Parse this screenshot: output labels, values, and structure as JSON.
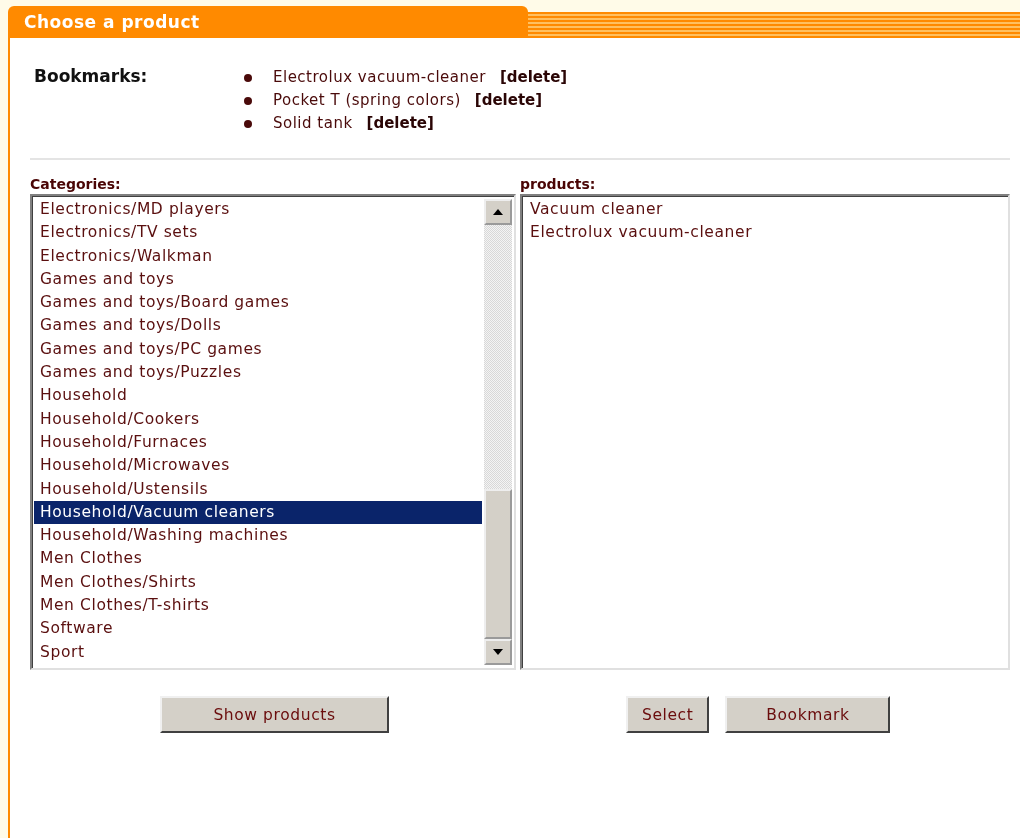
{
  "panel": {
    "title": "Choose a product"
  },
  "bookmarks": {
    "label": "Bookmarks:",
    "items": [
      {
        "name": "Electrolux vacuum-cleaner",
        "action": "[delete]"
      },
      {
        "name": "Pocket T (spring colors)",
        "action": "[delete]"
      },
      {
        "name": "Solid tank",
        "action": "[delete]"
      }
    ]
  },
  "categories": {
    "label": "Categories:",
    "items": [
      {
        "label": "Electronics/MD players",
        "selected": false
      },
      {
        "label": "Electronics/TV sets",
        "selected": false
      },
      {
        "label": "Electronics/Walkman",
        "selected": false
      },
      {
        "label": "Games and toys",
        "selected": false
      },
      {
        "label": "Games and toys/Board games",
        "selected": false
      },
      {
        "label": "Games and toys/Dolls",
        "selected": false
      },
      {
        "label": "Games and toys/PC games",
        "selected": false
      },
      {
        "label": "Games and toys/Puzzles",
        "selected": false
      },
      {
        "label": "Household",
        "selected": false
      },
      {
        "label": "Household/Cookers",
        "selected": false
      },
      {
        "label": "Household/Furnaces",
        "selected": false
      },
      {
        "label": "Household/Microwaves",
        "selected": false
      },
      {
        "label": "Household/Ustensils",
        "selected": false
      },
      {
        "label": "Household/Vacuum cleaners",
        "selected": true
      },
      {
        "label": "Household/Washing machines",
        "selected": false
      },
      {
        "label": "Men Clothes",
        "selected": false
      },
      {
        "label": "Men Clothes/Shirts",
        "selected": false
      },
      {
        "label": "Men Clothes/T-shirts",
        "selected": false
      },
      {
        "label": "Software",
        "selected": false
      },
      {
        "label": "Sport",
        "selected": false
      }
    ]
  },
  "products": {
    "label": "products:",
    "items": [
      {
        "label": "Vacuum cleaner",
        "selected": false
      },
      {
        "label": "Electrolux vacuum-cleaner",
        "selected": false
      }
    ]
  },
  "buttons": {
    "left": [
      "Show products"
    ],
    "right": [
      "Select",
      "Bookmark"
    ]
  }
}
